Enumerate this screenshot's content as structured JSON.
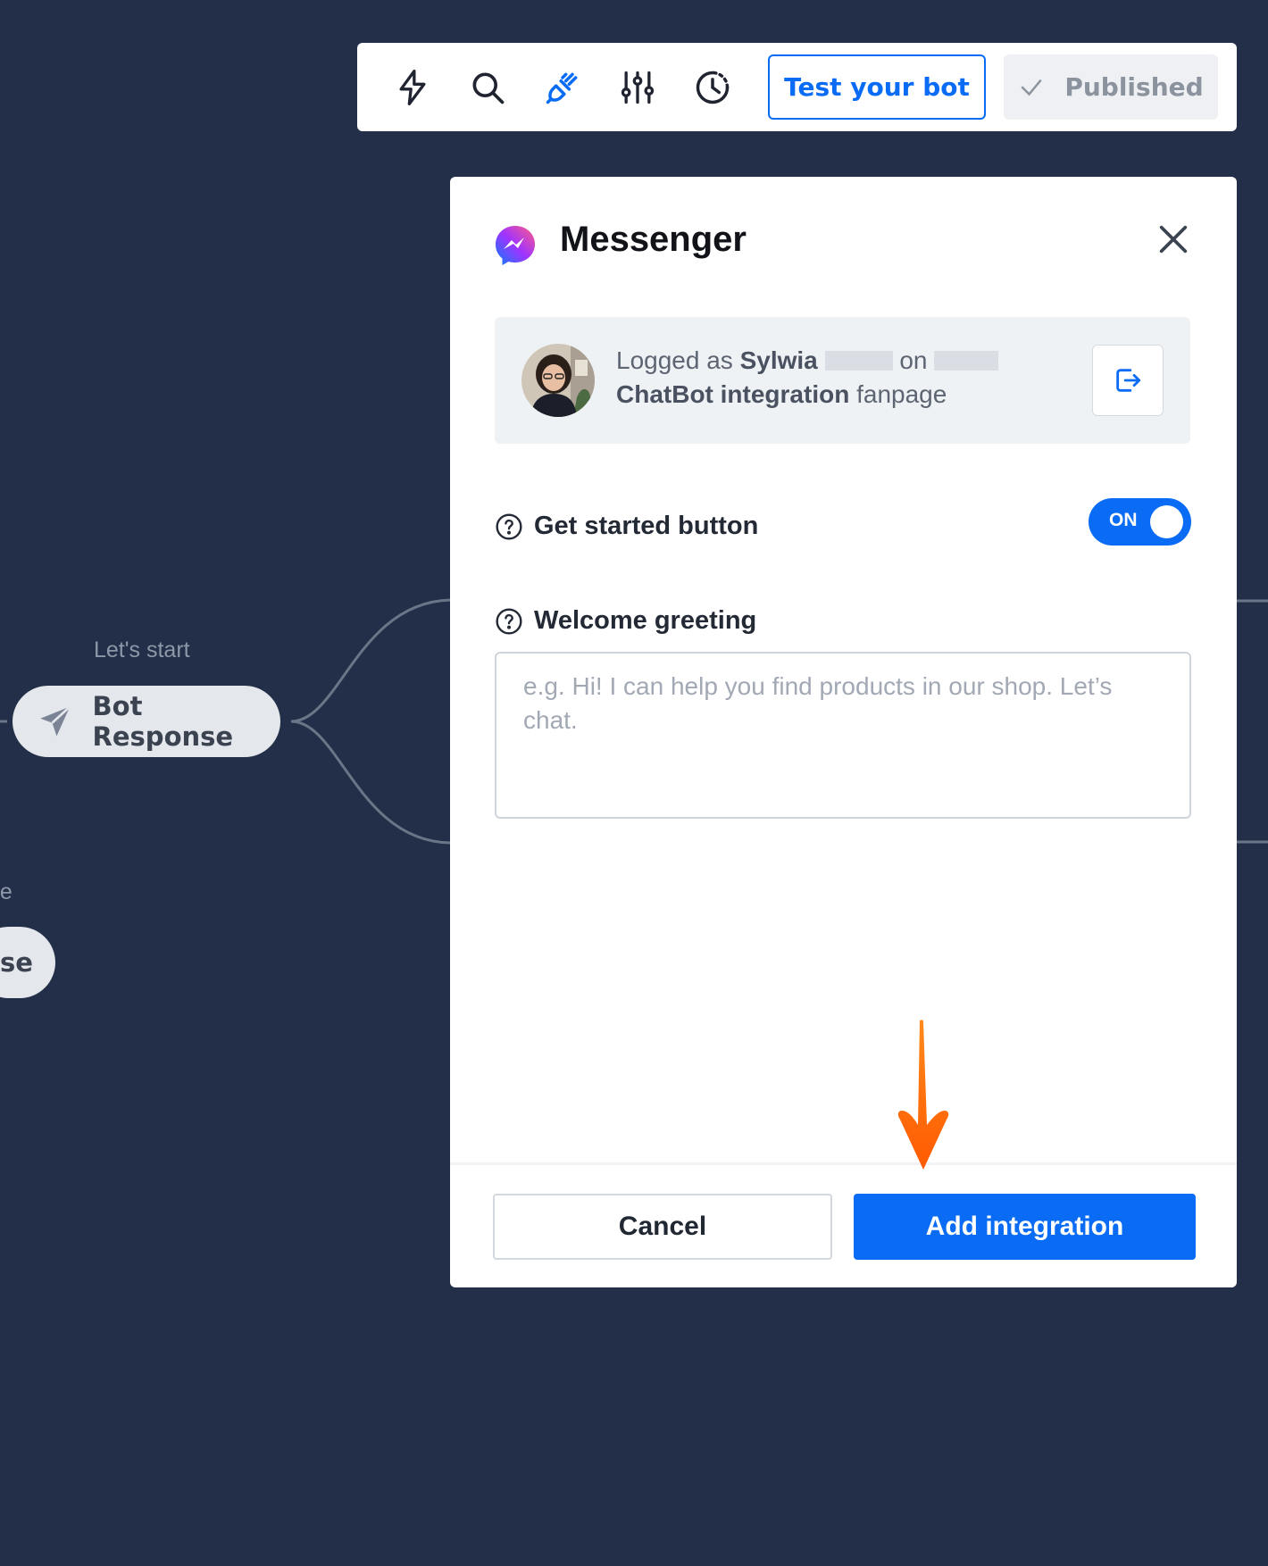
{
  "toolbar": {
    "icons": [
      "lightning-icon",
      "search-icon",
      "plug-icon",
      "sliders-icon",
      "history-icon"
    ],
    "test_label": "Test your bot",
    "published_label": "Published"
  },
  "canvas": {
    "main_caption": "Let's start",
    "main_node_label": "Bot Response",
    "left_caption": "ge",
    "left_node_label": "se"
  },
  "modal": {
    "title": "Messenger",
    "account": {
      "prefix": "Logged as",
      "name": "Sylwia",
      "on": "on",
      "page_name_part1": "ChatBot",
      "page_name_part2": "integration",
      "suffix": "fanpage"
    },
    "get_started": {
      "label": "Get started button",
      "toggle_label": "ON",
      "enabled": true
    },
    "welcome": {
      "label": "Welcome greeting",
      "value": "",
      "placeholder": "e.g. Hi! I can help you find products in our shop. Let’s chat."
    },
    "cancel_label": "Cancel",
    "add_label": "Add integration"
  },
  "colors": {
    "background": "#232f48",
    "accent": "#0a6cf5",
    "annotation": "#ff6a00"
  }
}
